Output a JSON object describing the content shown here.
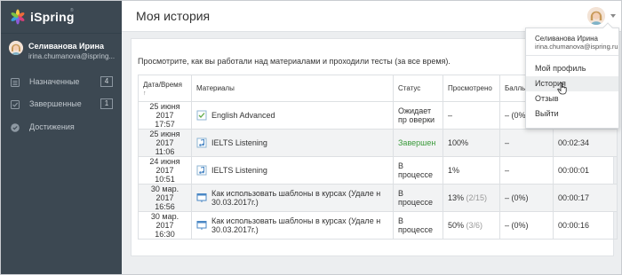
{
  "app": {
    "logo_text": "iSpring",
    "logo_mark": "®"
  },
  "header": {
    "title": "Моя история"
  },
  "user": {
    "name": "Селиванова Ирина",
    "email": "irina.chumanova@ispring..."
  },
  "sidebar": {
    "items": [
      {
        "label": "Назначенные",
        "count": "4",
        "icon": "list-icon"
      },
      {
        "label": "Завершенные",
        "count": "1",
        "icon": "checkbox-icon"
      },
      {
        "label": "Достижения",
        "count": "",
        "icon": "badge-icon"
      }
    ]
  },
  "content": {
    "intro": "Просмотрите, как вы работали над материалами и проходили тесты (за все время).",
    "columns": {
      "date": "Дата/Время",
      "sort_arrow": "↑",
      "materials": "Материалы",
      "status": "Статус",
      "viewed": "Просмотрено",
      "score": "Баллы"
    },
    "rows": [
      {
        "date": "25 июня 2017",
        "time": "17:57",
        "material": "English Advanced",
        "icon": "test-icon",
        "status": "Ожидает пр оверки",
        "viewed": "–",
        "viewed_detail": "",
        "score": "– (0%)",
        "duration": ""
      },
      {
        "date": "25 июня 2017",
        "time": "11:06",
        "material": "IELTS Listening",
        "icon": "audio-icon",
        "status": "Завершен",
        "viewed": "100%",
        "viewed_detail": "",
        "score": "–",
        "duration": "00:02:34"
      },
      {
        "date": "24 июня 2017",
        "time": "10:51",
        "material": "IELTS Listening",
        "icon": "audio-icon",
        "status": "В процессе",
        "viewed": "1%",
        "viewed_detail": "",
        "score": "–",
        "duration": "00:00:01"
      },
      {
        "date": "30 мар. 2017",
        "time": "16:56",
        "material": "Как использовать шаблоны в курсах (Удале н 30.03.2017г.)",
        "icon": "presentation-icon",
        "status": "В процессе",
        "viewed": "13%",
        "viewed_detail": "(2/15)",
        "score": "– (0%)",
        "duration": "00:00:17"
      },
      {
        "date": "30 мар. 2017",
        "time": "16:30",
        "material": "Как использовать шаблоны в курсах (Удале н 30.03.2017г.)",
        "icon": "presentation-icon",
        "status": "В процессе",
        "viewed": "50%",
        "viewed_detail": "(3/6)",
        "score": "– (0%)",
        "duration": "00:00:16"
      }
    ]
  },
  "user_menu": {
    "name": "Селиванова Ирина",
    "email": "irina.chumanova@ispring.ru",
    "items": [
      "Мой профиль",
      "История",
      "Отзыв",
      "Выйти"
    ],
    "hovered_item": "История"
  },
  "colors": {
    "sidebar_bg": "#3c4852",
    "completed_status": "#3a9a3a"
  }
}
